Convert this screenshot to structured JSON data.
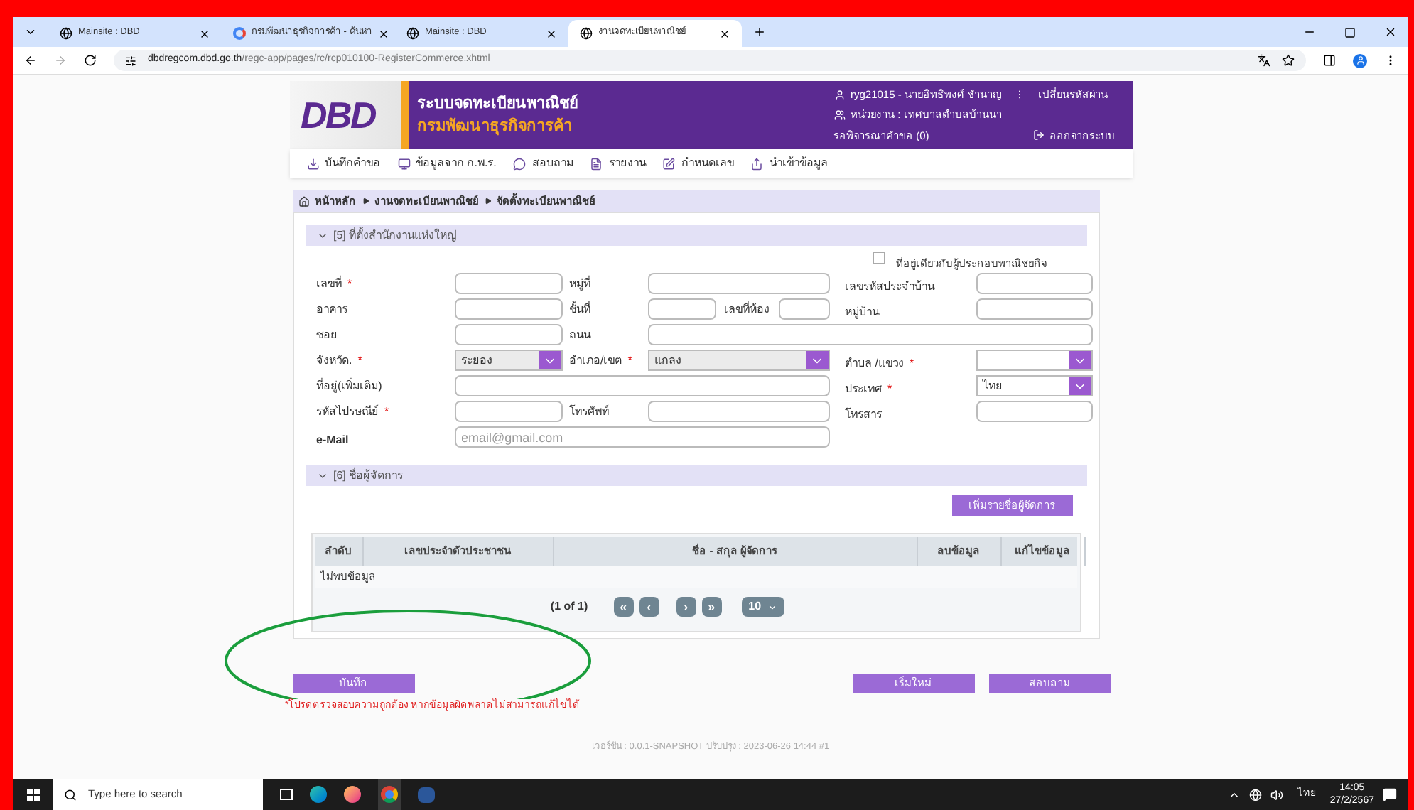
{
  "browser": {
    "tabs": [
      {
        "title": "Mainsite : DBD",
        "selected": false
      },
      {
        "title": "กรมพัฒนาธุรกิจการค้า - ค้นหา",
        "selected": false
      },
      {
        "title": "Mainsite : DBD",
        "selected": false
      },
      {
        "title": "งานจดทะเบียนพาณิชย์",
        "selected": true
      }
    ],
    "url_host": "dbdregcom.dbd.go.th",
    "url_path": "/regc-app/pages/rc/rcp010100-RegisterCommerce.xhtml"
  },
  "header": {
    "logo": "DBD",
    "title": "ระบบจดทะเบียนพาณิชย์",
    "subtitle": "กรมพัฒนาธุรกิจการค้า",
    "user": "ryg21015 - นายอิทธิพงศ์ ชำนาญ",
    "separator": "⁝",
    "change_password": "เปลี่ยนรหัสผ่าน",
    "unit": "หน่วยงาน : เทศบาลตำบลบ้านนา",
    "pending": "รอพิจารณาคำขอ (0)",
    "logout": "ออกจากระบบ"
  },
  "menu": [
    "บันทึกคำขอ",
    "ข้อมูลจาก ก.พ.ร.",
    "สอบถาม",
    "รายงาน",
    "กำหนดเลข",
    "นำเข้าข้อมูล"
  ],
  "breadcrumb": [
    "หน้าหลัก",
    "งานจดทะเบียนพาณิชย์",
    "จัดตั้งทะเบียนพาณิชย์"
  ],
  "section5": {
    "title": "[5] ที่ตั้งสำนักงานแห่งใหญ่",
    "expanded": true,
    "same_address": {
      "label": "ที่อยู่เดียวกับผู้ประกอบพาณิชยกิจ",
      "checked": false
    },
    "fields": [
      {
        "label": "เลขที่",
        "mark": "*",
        "kind": "text"
      },
      {
        "label": "หมู่ที่",
        "kind": "text"
      },
      {
        "label": "เลขรหัสประจำบ้าน",
        "kind": "text"
      },
      {
        "label": "อาคาร",
        "kind": "text"
      },
      {
        "label": "ชั้นที่",
        "kind": "text"
      },
      {
        "label": "เลขที่ห้อง",
        "kind": "text"
      },
      {
        "label": "หมู่บ้าน",
        "kind": "text"
      },
      {
        "label": "ซอย",
        "kind": "text"
      },
      {
        "label": "ถนน",
        "kind": "text"
      },
      {
        "label": "จังหวัด.",
        "mark": "*",
        "kind": "select",
        "value": "ระยอง",
        "disabled": true
      },
      {
        "label": "อำเภอ/เขต",
        "mark": "*",
        "kind": "select",
        "value": "แกลง",
        "disabled": true
      },
      {
        "label": "ตำบล /แขวง",
        "mark": "*",
        "kind": "select",
        "disabled": false
      },
      {
        "label": "ที่อยู่(เพิ่มเติม)",
        "kind": "text"
      },
      {
        "label": "ประเทศ",
        "mark": "*",
        "kind": "select",
        "value": "ไทย",
        "disabled": false
      },
      {
        "label": "รหัสไปรษณีย์",
        "mark": "*",
        "kind": "text"
      },
      {
        "label": "โทรศัพท์",
        "kind": "text"
      },
      {
        "label": "โทรสาร",
        "kind": "text"
      },
      {
        "label": "e-Mail",
        "kind": "text",
        "placeholder": "email@gmail.com"
      }
    ]
  },
  "section6": {
    "title": "[6] ชื่อผู้จัดการ",
    "expanded": true,
    "add_button": "เพิ่มรายชื่อผู้จัดการ",
    "columns": [
      "ลำดับ",
      "เลขประจำตัวประชาชน",
      "ชื่อ - สกุล ผู้จัดการ",
      "ลบข้อมูล",
      "แก้ไขข้อมูล"
    ],
    "empty": "ไม่พบข้อมูล",
    "pager": {
      "info": "(1 of 1)",
      "first": "«",
      "prev": "‹",
      "next": "›",
      "last": "»",
      "page_size": "10"
    }
  },
  "actions": {
    "save": "บันทึก",
    "reset": "เริ่มใหม่",
    "inquire": "สอบถาม"
  },
  "note": "*โปรดตรวจสอบความถูกต้อง หากข้อมูลผิดพลาดไม่สามารถแก้ไขได้",
  "footer": "เวอร์ชัน : 0.0.1-SNAPSHOT ปรับปรุง : 2023-06-26 14:44 #1",
  "taskbar": {
    "search_placeholder": "Type here to search",
    "language": "ไทย",
    "time": "14:05",
    "date": "27/2/2567"
  }
}
